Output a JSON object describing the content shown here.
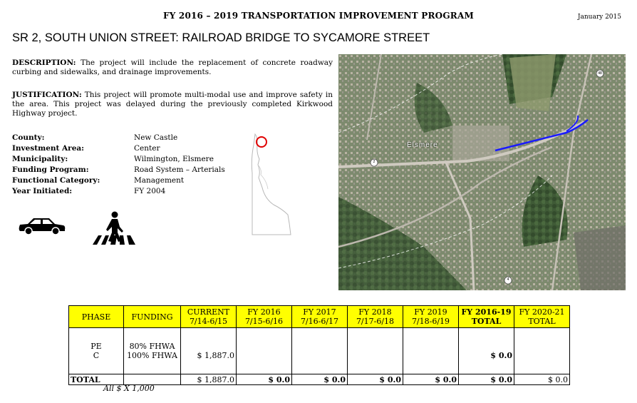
{
  "header": {
    "program_title": "FY 2016 – 2019 TRANSPORTATION IMPROVEMENT PROGRAM",
    "date": "January 2015"
  },
  "project": {
    "title": "SR 2, SOUTH UNION STREET: RAILROAD BRIDGE TO SYCAMORE STREET",
    "description_label": "DESCRIPTION:",
    "description_text": "The project will include the replacement of concrete roadway curbing and sidewalks, and drainage improvements.",
    "justification_label": "JUSTIFICATION:",
    "justification_text": "This project will promote multi-modal use and improve safety in the area.  This project was delayed during the previously completed Kirkwood Highway project."
  },
  "info": [
    {
      "label": "County:",
      "value": "New Castle"
    },
    {
      "label": "Investment Area:",
      "value": "Center"
    },
    {
      "label": "Municipality:",
      "value": "Wilmington, Elsmere"
    },
    {
      "label": "Funding Program:",
      "value": "Road System – Arterials"
    },
    {
      "label": "Functional Category:",
      "value": "Management"
    },
    {
      "label": "Year Initiated:",
      "value": "FY 2004"
    }
  ],
  "map": {
    "place_label": "Elsmere",
    "route_shields": [
      "2",
      "48",
      "4"
    ]
  },
  "icons": {
    "car": "car-icon",
    "pedestrian": "pedestrian-crossing-icon",
    "locator": "delaware-locator-map-icon"
  },
  "table": {
    "headers": [
      {
        "line1": "PHASE",
        "line2": ""
      },
      {
        "line1": "FUNDING",
        "line2": ""
      },
      {
        "line1": "CURRENT",
        "line2": "7/14-6/15"
      },
      {
        "line1": "FY 2016",
        "line2": "7/15-6/16"
      },
      {
        "line1": "FY 2017",
        "line2": "7/16-6/17"
      },
      {
        "line1": "FY 2018",
        "line2": "7/17-6/18"
      },
      {
        "line1": "FY 2019",
        "line2": "7/18-6/19"
      },
      {
        "line1": "FY 2016-19",
        "line2": "TOTAL"
      },
      {
        "line1": "FY 2020-21",
        "line2": "TOTAL"
      }
    ],
    "phases": [
      "PE",
      "C"
    ],
    "funding": [
      "80% FHWA",
      "100% FHWA"
    ],
    "current_c": "$ 1,887.0",
    "fy16_19_total_c": "$ 0.0",
    "totals": {
      "label": "TOTAL",
      "current": "$ 1,887.0",
      "fy2016": "$ 0.0",
      "fy2017": "$ 0.0",
      "fy2018": "$ 0.0",
      "fy2019": "$ 0.0",
      "fy16_19": "$ 0.0",
      "fy20_21": "$ 0.0"
    },
    "note": "All $ X 1,000"
  },
  "colors": {
    "header_fill": "#ffff00",
    "route_line": "#1a1aff",
    "locator_circle": "#e00000"
  }
}
